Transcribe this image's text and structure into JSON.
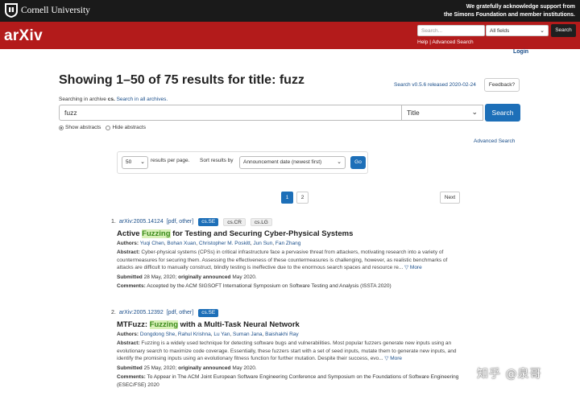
{
  "topbar": {
    "institution": "Cornell University",
    "ack_line1": "We gratefully acknowledge support from",
    "ack_line2": "the Simons Foundation and member institutions."
  },
  "header": {
    "logo": "arXiv",
    "search_placeholder": "Search...",
    "field_select": "All fields",
    "search_button": "Search",
    "help_link": "Help",
    "separator": "|",
    "advanced_link": "Advanced Search",
    "login": "Login"
  },
  "main": {
    "heading": "Showing 1–50 of 75 results for title: fuzz",
    "release_note": "Search v0.5.6 released 2020-02-24",
    "feedback_button": "Feedback?",
    "archive_prefix": "Searching in archive",
    "archive_name": "cs.",
    "archive_link": "Search in all archives.",
    "query_value": "fuzz",
    "field_value": "Title",
    "search_button": "Search",
    "show_abstracts": "Show abstracts",
    "hide_abstracts": "Hide abstracts",
    "advanced_search": "Advanced Search"
  },
  "options": {
    "per_page_value": "50",
    "per_page_label": "results per page.",
    "sort_label": "Sort results by",
    "sort_value": "Announcement date (newest first)",
    "go_button": "Go"
  },
  "pagination": {
    "pages": [
      "1",
      "2"
    ],
    "next": "Next"
  },
  "results": [
    {
      "number": "1.",
      "id": "arXiv:2005.14124",
      "pdf": "[pdf, other]",
      "primary": "cs.SE",
      "secondary": [
        "cs.CR",
        "cs.LG"
      ],
      "title_before": "Active ",
      "title_hl": "Fuzzing",
      "title_after": " for Testing and Securing Cyber-Physical Systems",
      "authors_label": "Authors:",
      "authors": [
        "Yuqi Chen",
        "Bohan Xuan",
        "Christopher M. Poskitt",
        "Jun Sun",
        "Fan Zhang"
      ],
      "abstract_label": "Abstract:",
      "abstract": "Cyber-physical systems (CPSs) in critical infrastructure face a pervasive threat from attackers, motivating research into a variety of countermeasures for securing them. Assessing the effectiveness of these countermeasures is challenging, however, as realistic benchmarks of attacks are difficult to manually construct, blindly testing is ineffective due to the enormous search spaces and resource re...",
      "more": "▽ More",
      "submitted_label": "Submitted",
      "submitted": "28 May, 2020;",
      "announced_label": "originally announced",
      "announced": "May 2020.",
      "comments_label": "Comments:",
      "comments": "Accepted by the ACM SIGSOFT International Symposium on Software Testing and Analysis (ISSTA 2020)"
    },
    {
      "number": "2.",
      "id": "arXiv:2005.12392",
      "pdf": "[pdf, other]",
      "primary": "cs.SE",
      "secondary": [],
      "title_before": "MTFuzz: ",
      "title_hl": "Fuzzing",
      "title_after": " with a Multi-Task Neural Network",
      "authors_label": "Authors:",
      "authors": [
        "Dongdong She",
        "Rahul Krishna",
        "Lu Yan",
        "Suman Jana",
        "Baishakhi Ray"
      ],
      "abstract_label": "Abstract:",
      "abstract": "Fuzzing is a widely used technique for detecting software bugs and vulnerabilities. Most popular fuzzers generate new inputs using an evolutionary search to maximize code coverage. Essentially, these fuzzers start with a set of seed inputs, mutate them to generate new inputs, and identify the promising inputs using an evolutionary fitness function for further mutation. Despite their success, evo...",
      "more": "▽ More",
      "submitted_label": "Submitted",
      "submitted": "25 May, 2020;",
      "announced_label": "originally announced",
      "announced": "May 2020.",
      "comments_label": "Comments:",
      "comments": "To Appear in The ACM Joint European Software Engineering Conference and Symposium on the Foundations of Software Engineering (ESEC/FSE) 2020"
    }
  ],
  "watermark": "知乎 @泉哥"
}
